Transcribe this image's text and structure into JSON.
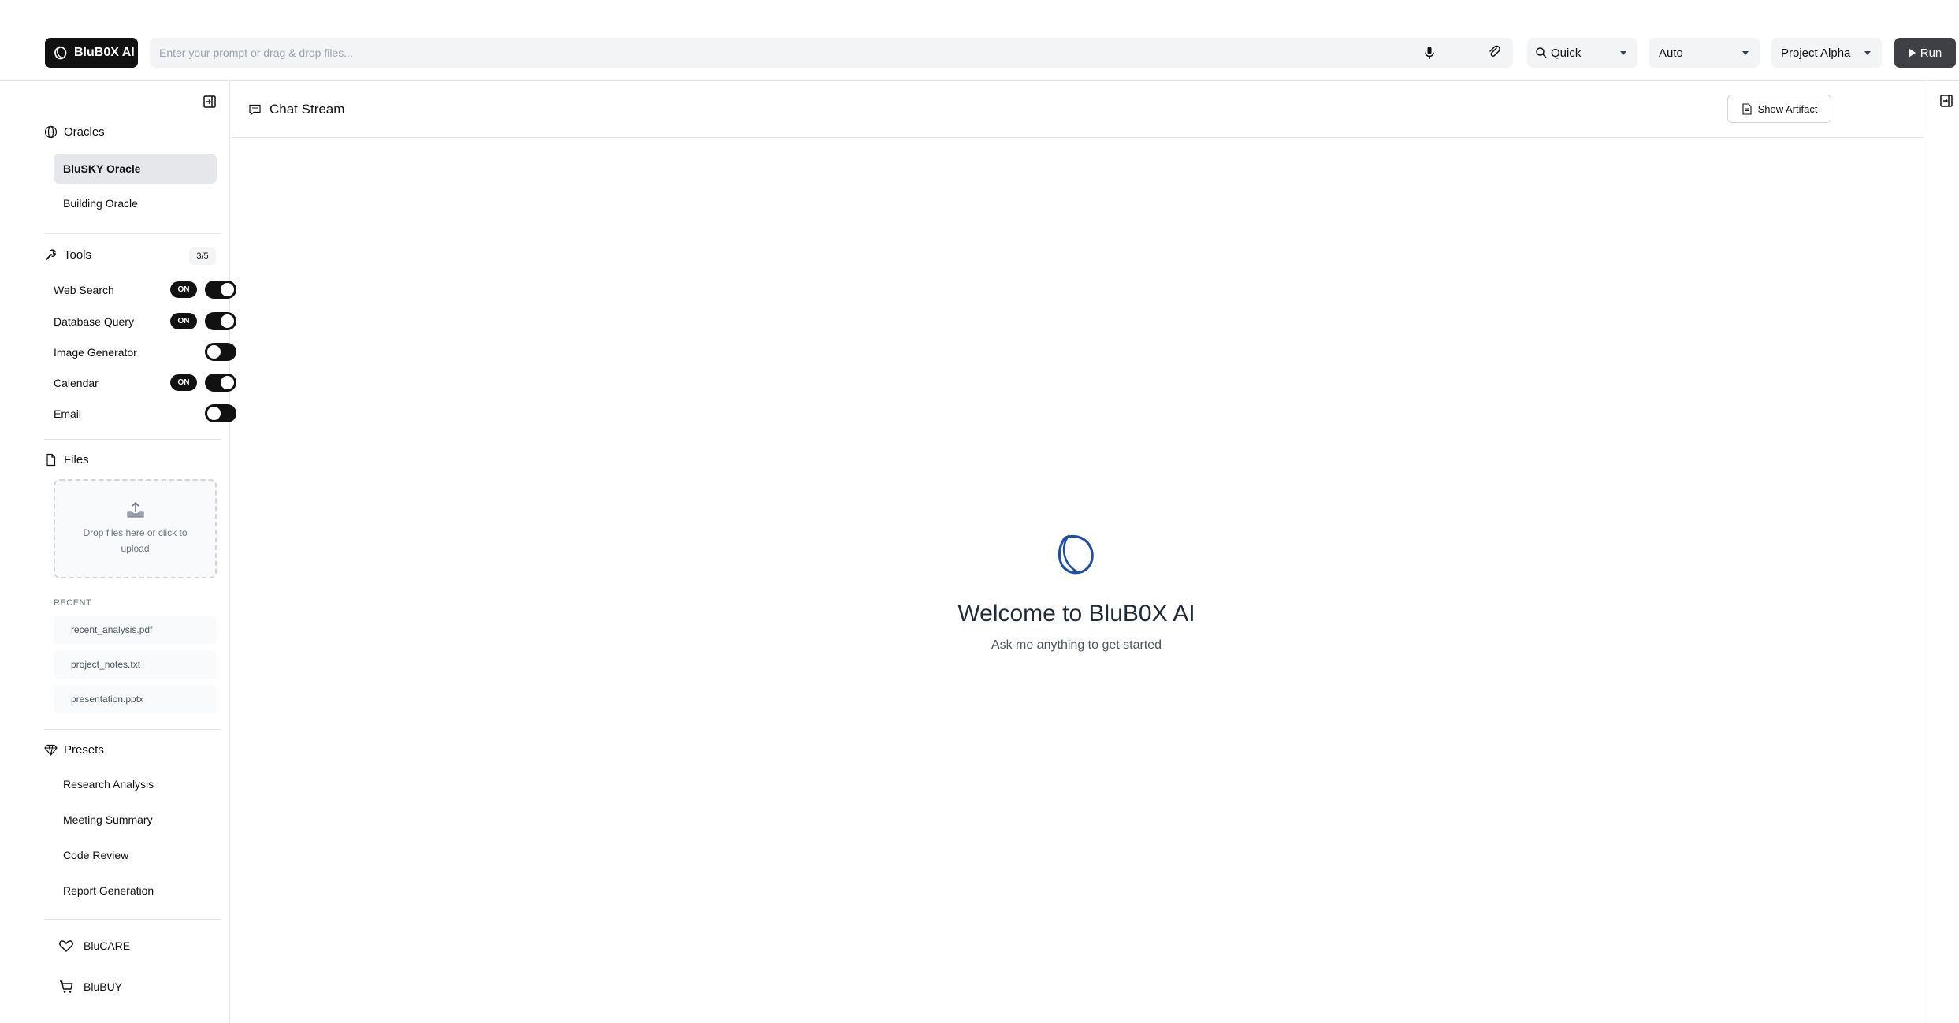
{
  "header": {
    "app_name": "BluB0X AI",
    "prompt_placeholder": "Enter your prompt or drag & drop files...",
    "mode_select": "Quick",
    "model_select": "Auto",
    "project_select": "Project Alpha",
    "run_label": "Run"
  },
  "sidebar": {
    "oracles_title": "Oracles",
    "oracles": [
      {
        "label": "BluSKY Oracle",
        "active": true
      },
      {
        "label": "Building Oracle",
        "active": false
      }
    ],
    "tools_title": "Tools",
    "tools_count": "3/5",
    "on_label": "ON",
    "tools": [
      {
        "label": "Web Search",
        "on": true
      },
      {
        "label": "Database Query",
        "on": true
      },
      {
        "label": "Image Generator",
        "on": false
      },
      {
        "label": "Calendar",
        "on": true
      },
      {
        "label": "Email",
        "on": false
      }
    ],
    "files_title": "Files",
    "dropzone_text": "Drop files here or click to upload",
    "recent_label": "RECENT",
    "recent_files": [
      "recent_analysis.pdf",
      "project_notes.txt",
      "presentation.pptx"
    ],
    "presets_title": "Presets",
    "presets": [
      "Research Analysis",
      "Meeting Summary",
      "Code Review",
      "Report Generation"
    ],
    "links": [
      {
        "label": "BluCARE",
        "icon": "heart-icon"
      },
      {
        "label": "BluBUY",
        "icon": "cart-icon"
      }
    ]
  },
  "main": {
    "chat_title": "Chat Stream",
    "show_artifact_label": "Show Artifact",
    "welcome_title": "Welcome to BluB0X AI",
    "welcome_subtitle": "Ask me anything to get started"
  },
  "colors": {
    "brand_dark": "#111111",
    "accent_blue": "#1e4fa8",
    "run_button": "#3f3f46"
  }
}
